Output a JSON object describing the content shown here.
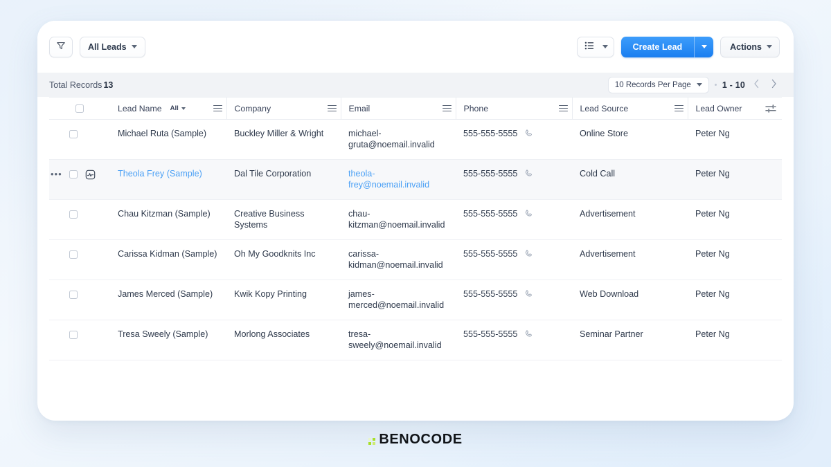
{
  "toolbar": {
    "filter_icon": "funnel-icon",
    "view_filter_label": "All Leads",
    "view_mode_icon": "list-view-icon",
    "create_label": "Create Lead",
    "actions_label": "Actions"
  },
  "records_bar": {
    "total_label": "Total Records",
    "total_count": "13",
    "records_per_page": "10 Records Per Page",
    "range": "1 - 10",
    "prev_icon": "chevron-left-icon",
    "next_icon": "chevron-right-icon"
  },
  "table": {
    "columns": [
      {
        "label": "Lead Name",
        "sort": "All"
      },
      {
        "label": "Company"
      },
      {
        "label": "Email"
      },
      {
        "label": "Phone"
      },
      {
        "label": "Lead Source"
      },
      {
        "label": "Lead Owner"
      }
    ],
    "settings_icon": "column-settings-icon",
    "rows": [
      {
        "name": "Michael Ruta (Sample)",
        "company": "Buckley Miller & Wright",
        "email": "michael-gruta@noemail.invalid",
        "phone": "555-555-5555",
        "source": "Online Store",
        "owner": "Peter Ng"
      },
      {
        "name": "Theola Frey (Sample)",
        "company": "Dal Tile Corporation",
        "email": "theola-frey@noemail.invalid",
        "phone": "555-555-5555",
        "source": "Cold Call",
        "owner": "Peter Ng"
      },
      {
        "name": "Chau Kitzman (Sample)",
        "company": "Creative Business Systems",
        "email": "chau-kitzman@noemail.invalid",
        "phone": "555-555-5555",
        "source": "Advertisement",
        "owner": "Peter Ng"
      },
      {
        "name": "Carissa Kidman (Sample)",
        "company": "Oh My Goodknits Inc",
        "email": "carissa-kidman@noemail.invalid",
        "phone": "555-555-5555",
        "source": "Advertisement",
        "owner": "Peter Ng"
      },
      {
        "name": "James Merced (Sample)",
        "company": "Kwik Kopy Printing",
        "email": "james-merced@noemail.invalid",
        "phone": "555-555-5555",
        "source": "Web Download",
        "owner": "Peter Ng"
      },
      {
        "name": "Tresa Sweely (Sample)",
        "company": "Morlong Associates",
        "email": "tresa-sweely@noemail.invalid",
        "phone": "555-555-5555",
        "source": "Seminar Partner",
        "owner": "Peter Ng"
      }
    ],
    "hovered_row_index": 1,
    "row_more_icon": "more-horizontal-icon",
    "row_action_icon": "activity-square-icon",
    "phone_icon": "phone-icon"
  },
  "brand": {
    "name": "BENOCODE",
    "accent": "#a8e02a"
  },
  "colors": {
    "primary": "#1a7ef0",
    "link": "#4ba0f5",
    "text": "#2f3a4c",
    "strip_bg": "#f1f3f6"
  }
}
